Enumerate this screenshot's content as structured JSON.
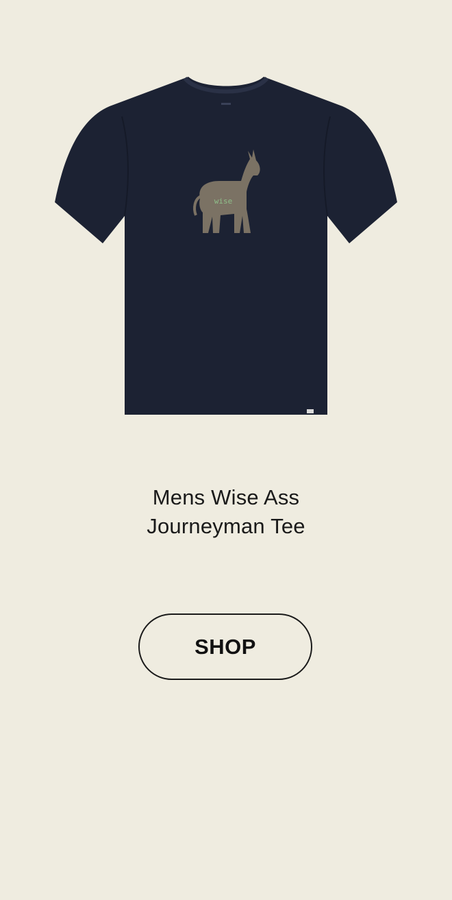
{
  "product": {
    "image_icon": "t-shirt-donkey-graphic",
    "graphic_text": "wise",
    "title_line1": "Mens Wise Ass",
    "title_line2": "Journeyman Tee"
  },
  "cta": {
    "label": "SHOP"
  },
  "colors": {
    "background": "#efece0",
    "shirt": "#1c2233",
    "graphic": "#7b7264",
    "graphic_text": "#8fbf8a",
    "text": "#1a1a1a"
  }
}
